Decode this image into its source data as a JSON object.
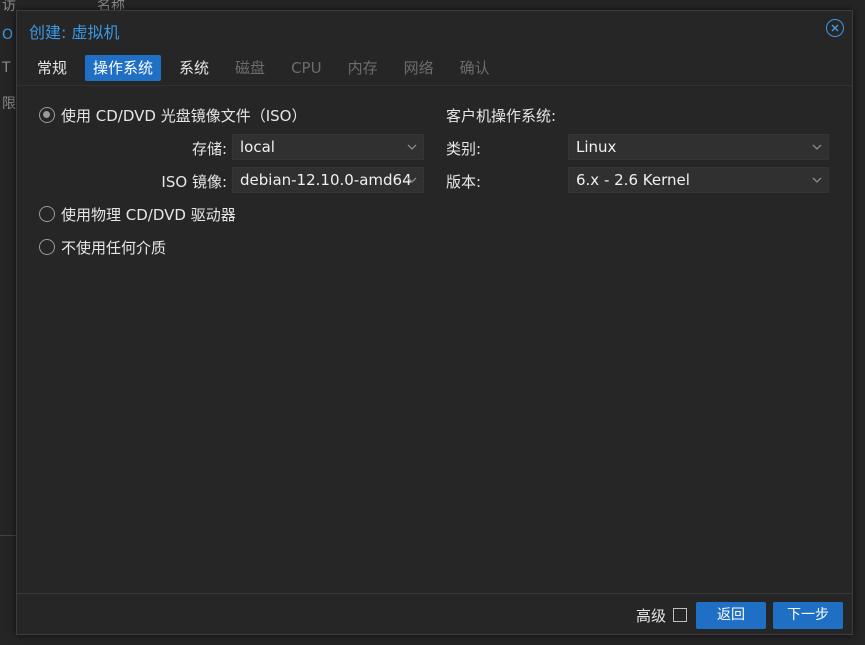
{
  "background": {
    "fragments": [
      "访",
      "名称",
      "O",
      "T",
      "限"
    ]
  },
  "dialog": {
    "title": "创建: 虚拟机",
    "close_icon": "close-icon",
    "tabs": [
      {
        "label": "常规",
        "state": "normal"
      },
      {
        "label": "操作系统",
        "state": "active"
      },
      {
        "label": "系统",
        "state": "normal"
      },
      {
        "label": "磁盘",
        "state": "disabled"
      },
      {
        "label": "CPU",
        "state": "disabled"
      },
      {
        "label": "内存",
        "state": "disabled"
      },
      {
        "label": "网络",
        "state": "disabled"
      },
      {
        "label": "确认",
        "state": "disabled"
      }
    ],
    "media": {
      "option_iso": "使用 CD/DVD 光盘镜像文件（ISO）",
      "storage_label": "存储:",
      "storage_value": "local",
      "iso_label": "ISO 镜像:",
      "iso_value": "debian-12.10.0-amd64",
      "option_physical": "使用物理 CD/DVD 驱动器",
      "option_none": "不使用任何介质",
      "selected": "iso"
    },
    "guest_os": {
      "heading": "客户机操作系统:",
      "type_label": "类别:",
      "type_value": "Linux",
      "version_label": "版本:",
      "version_value": "6.x - 2.6 Kernel"
    },
    "footer": {
      "advanced_label": "高级",
      "advanced_checked": false,
      "back_label": "返回",
      "next_label": "下一步"
    }
  },
  "colors": {
    "accent": "#3a99e6",
    "button": "#1f6fc4",
    "dialog_bg": "#262626"
  }
}
